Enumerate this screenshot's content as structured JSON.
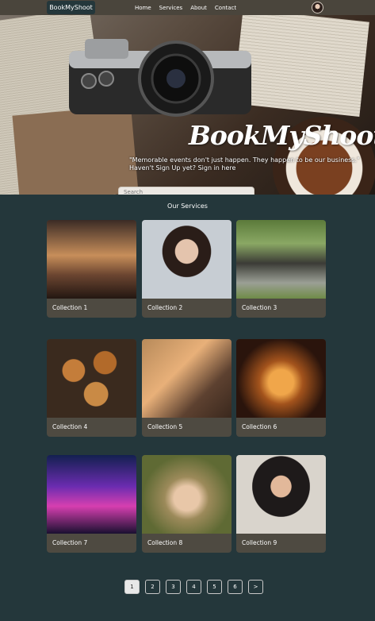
{
  "nav": {
    "brand": "BookMyShoot",
    "links": [
      "Home",
      "Services",
      "About",
      "Contact"
    ]
  },
  "hero": {
    "title": "BookMyShoot",
    "tagline_1": "\"Memorable events don't just happen. They happen to be our business.\"",
    "tagline_2": "Haven't Sign Up yet? Sign in here",
    "search_placeholder": "Search"
  },
  "services": {
    "title": "Our Services",
    "cards": [
      {
        "caption": "Collection 1"
      },
      {
        "caption": "Collection 2"
      },
      {
        "caption": "Collection 3"
      },
      {
        "caption": "Collection 4"
      },
      {
        "caption": "Collection 5"
      },
      {
        "caption": "Collection 6"
      },
      {
        "caption": "Collection 7"
      },
      {
        "caption": "Collection 8"
      },
      {
        "caption": "Collection 9"
      }
    ]
  },
  "pagination": {
    "pages": [
      "1",
      "2",
      "3",
      "4",
      "5",
      "6"
    ],
    "next": ">",
    "current": "1"
  },
  "colors": {
    "background": "#24373b",
    "navbar": "#4a453c",
    "card_caption_bg": "#4e4a41"
  }
}
